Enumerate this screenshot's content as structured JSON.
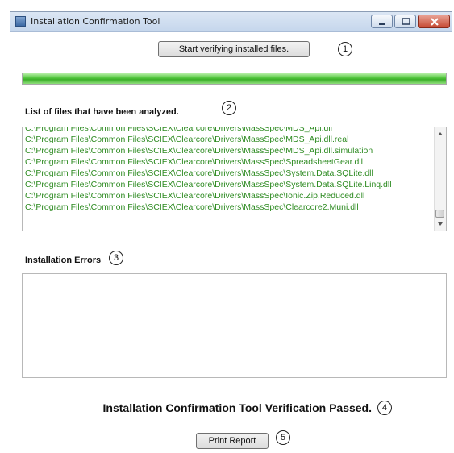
{
  "window": {
    "title": "Installation Confirmation Tool",
    "icon": "app-icon",
    "controls": [
      "minimize-icon",
      "maximize-icon",
      "close-icon"
    ]
  },
  "toolbar": {
    "start_button_label": "Start verifying installed files."
  },
  "markers": [
    "1",
    "2",
    "3",
    "4",
    "5"
  ],
  "progress": {
    "value_percent": 100,
    "color": "#3caf2a"
  },
  "files_section": {
    "heading": "List of files that have been analyzed.",
    "items": [
      "C:\\Program Files\\Common Files\\SCIEX\\Clearcore\\Drivers\\MassSpec\\MDS_Api.dll",
      "C:\\Program Files\\Common Files\\SCIEX\\Clearcore\\Drivers\\MassSpec\\MDS_Api.dll.real",
      "C:\\Program Files\\Common Files\\SCIEX\\Clearcore\\Drivers\\MassSpec\\MDS_Api.dll.simulation",
      "C:\\Program Files\\Common Files\\SCIEX\\Clearcore\\Drivers\\MassSpec\\SpreadsheetGear.dll",
      "C:\\Program Files\\Common Files\\SCIEX\\Clearcore\\Drivers\\MassSpec\\System.Data.SQLite.dll",
      "C:\\Program Files\\Common Files\\SCIEX\\Clearcore\\Drivers\\MassSpec\\System.Data.SQLite.Linq.dll",
      "C:\\Program Files\\Common Files\\SCIEX\\Clearcore\\Drivers\\MassSpec\\Ionic.Zip.Reduced.dll",
      "C:\\Program Files\\Common Files\\SCIEX\\Clearcore\\Drivers\\MassSpec\\Clearcore2.Muni.dll"
    ],
    "text_color": "#2e8b22"
  },
  "errors_section": {
    "heading": "Installation Errors",
    "items": []
  },
  "status": {
    "message": "Installation Confirmation Tool Verification Passed."
  },
  "footer": {
    "print_button_label": "Print Report"
  }
}
